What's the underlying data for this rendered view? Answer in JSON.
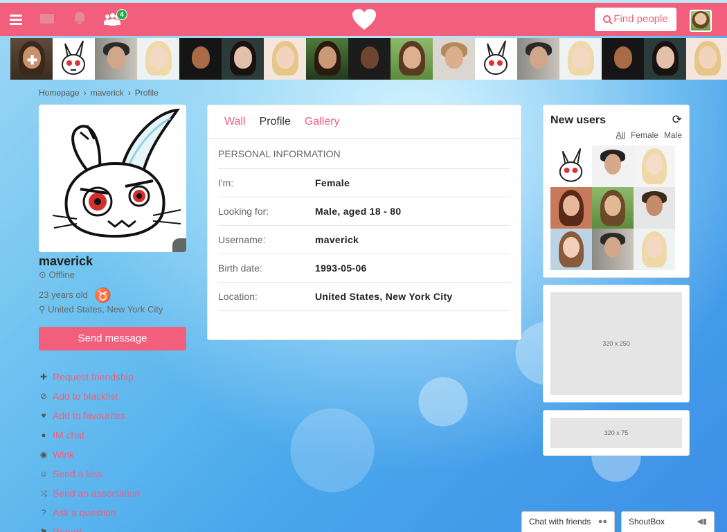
{
  "topbar": {
    "friend_requests_count": "4",
    "find_people_label": "Find people",
    "accent_color": "#f25f7c"
  },
  "breadcrumb": [
    "Homepage",
    "maverick",
    "Profile"
  ],
  "profile": {
    "username": "maverick",
    "status": "Offline",
    "age": "23 years old",
    "zodiac_symbol": "♉",
    "location": "United States, New York City",
    "send_message_label": "Send message"
  },
  "actions": [
    {
      "icon": "plus-icon",
      "glyph": "✚",
      "label": "Request friendship"
    },
    {
      "icon": "ban-icon",
      "glyph": "⊘",
      "label": "Add to blacklist"
    },
    {
      "icon": "heart-icon",
      "glyph": "♥",
      "label": "Add to favourites"
    },
    {
      "icon": "chat-bubbles-icon",
      "glyph": "●",
      "label": "IM chat"
    },
    {
      "icon": "eye-icon",
      "glyph": "◉",
      "label": "Wink"
    },
    {
      "icon": "smile-icon",
      "glyph": "☺",
      "label": "Send a kiss"
    },
    {
      "icon": "shuffle-icon",
      "glyph": "⤨",
      "label": "Send an association"
    },
    {
      "icon": "question-icon",
      "glyph": "?",
      "label": "Ask a question"
    },
    {
      "icon": "flag-icon",
      "glyph": "⚑",
      "label": "Report"
    }
  ],
  "tabs": [
    {
      "label": "Wall",
      "active": false
    },
    {
      "label": "Profile",
      "active": true
    },
    {
      "label": "Gallery",
      "active": false
    }
  ],
  "personal_info": {
    "title": "PERSONAL INFORMATION",
    "rows": [
      {
        "key": "I'm:",
        "value": "Female"
      },
      {
        "key": "Looking for:",
        "value": "Male, aged 18 - 80"
      },
      {
        "key": "Username:",
        "value": "maverick"
      },
      {
        "key": "Birth date:",
        "value": "1993-05-06"
      },
      {
        "key": "Location:",
        "value": "United States, New York City"
      }
    ]
  },
  "new_users": {
    "title": "New users",
    "filters": [
      {
        "label": "All",
        "selected": true
      },
      {
        "label": "Female",
        "selected": false
      },
      {
        "label": "Male",
        "selected": false
      }
    ]
  },
  "ads": {
    "box1_label": "320 x 250",
    "box2_label": "320 x 75"
  },
  "chatbar": {
    "chat_with_friends": "Chat with friends",
    "shoutbox": "ShoutBox"
  }
}
